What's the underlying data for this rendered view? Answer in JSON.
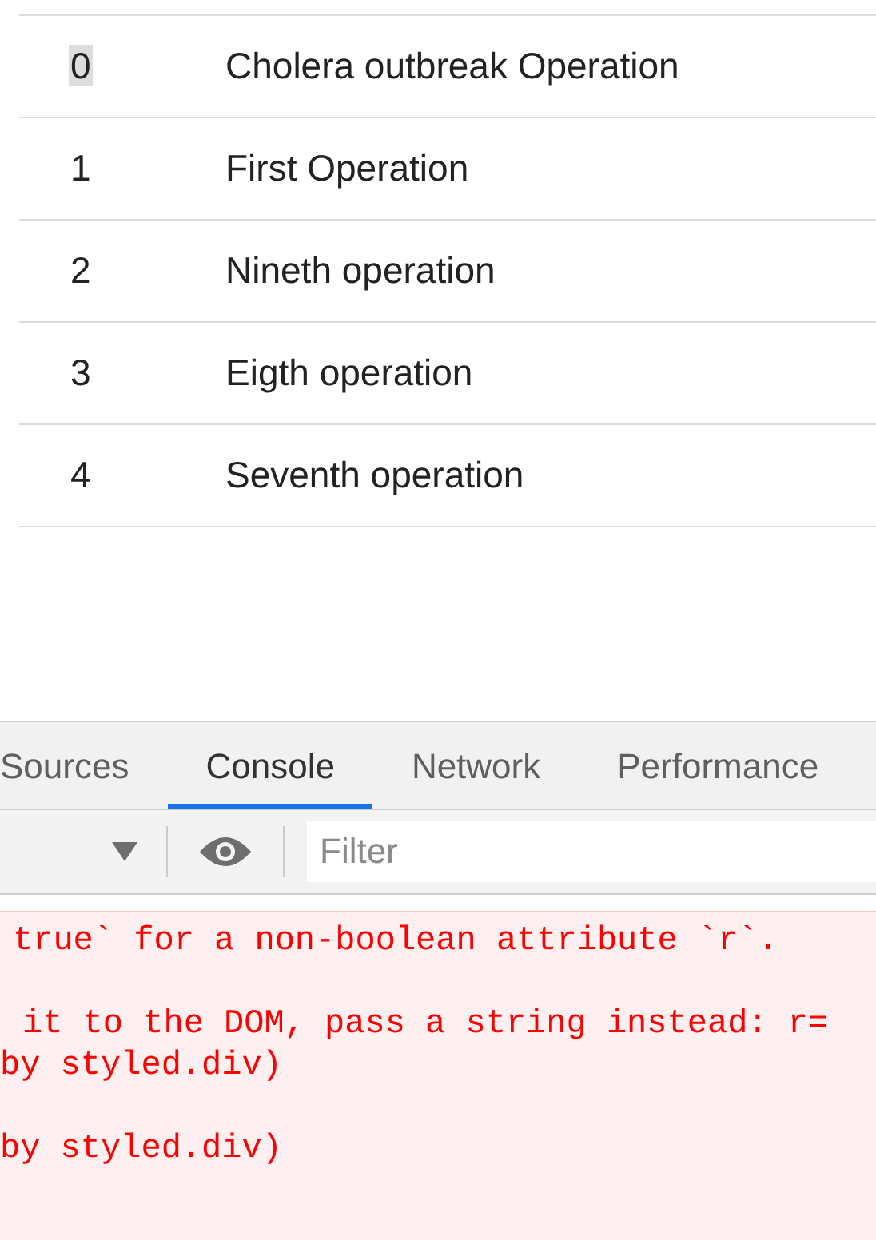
{
  "table": {
    "rows": [
      {
        "index": "0",
        "name": "Cholera outbreak Operation",
        "highlighted": true
      },
      {
        "index": "1",
        "name": "First Operation",
        "highlighted": false
      },
      {
        "index": "2",
        "name": "Nineth operation",
        "highlighted": false
      },
      {
        "index": "3",
        "name": "Eigth operation",
        "highlighted": false
      },
      {
        "index": "4",
        "name": "Seventh operation",
        "highlighted": false
      }
    ]
  },
  "devtools": {
    "tabs": [
      {
        "label": "Sources",
        "selected": false
      },
      {
        "label": "Console",
        "selected": true
      },
      {
        "label": "Network",
        "selected": false
      },
      {
        "label": "Performance",
        "selected": false
      }
    ],
    "filter": {
      "placeholder": "Filter"
    },
    "console_lines": [
      {
        "text": "true` for a non-boolean attribute `r`."
      },
      {
        "text": "it to the DOM, pass a string instead: r="
      },
      {
        "text": "by styled.div)"
      },
      {
        "text": "by styled.div)"
      }
    ]
  }
}
